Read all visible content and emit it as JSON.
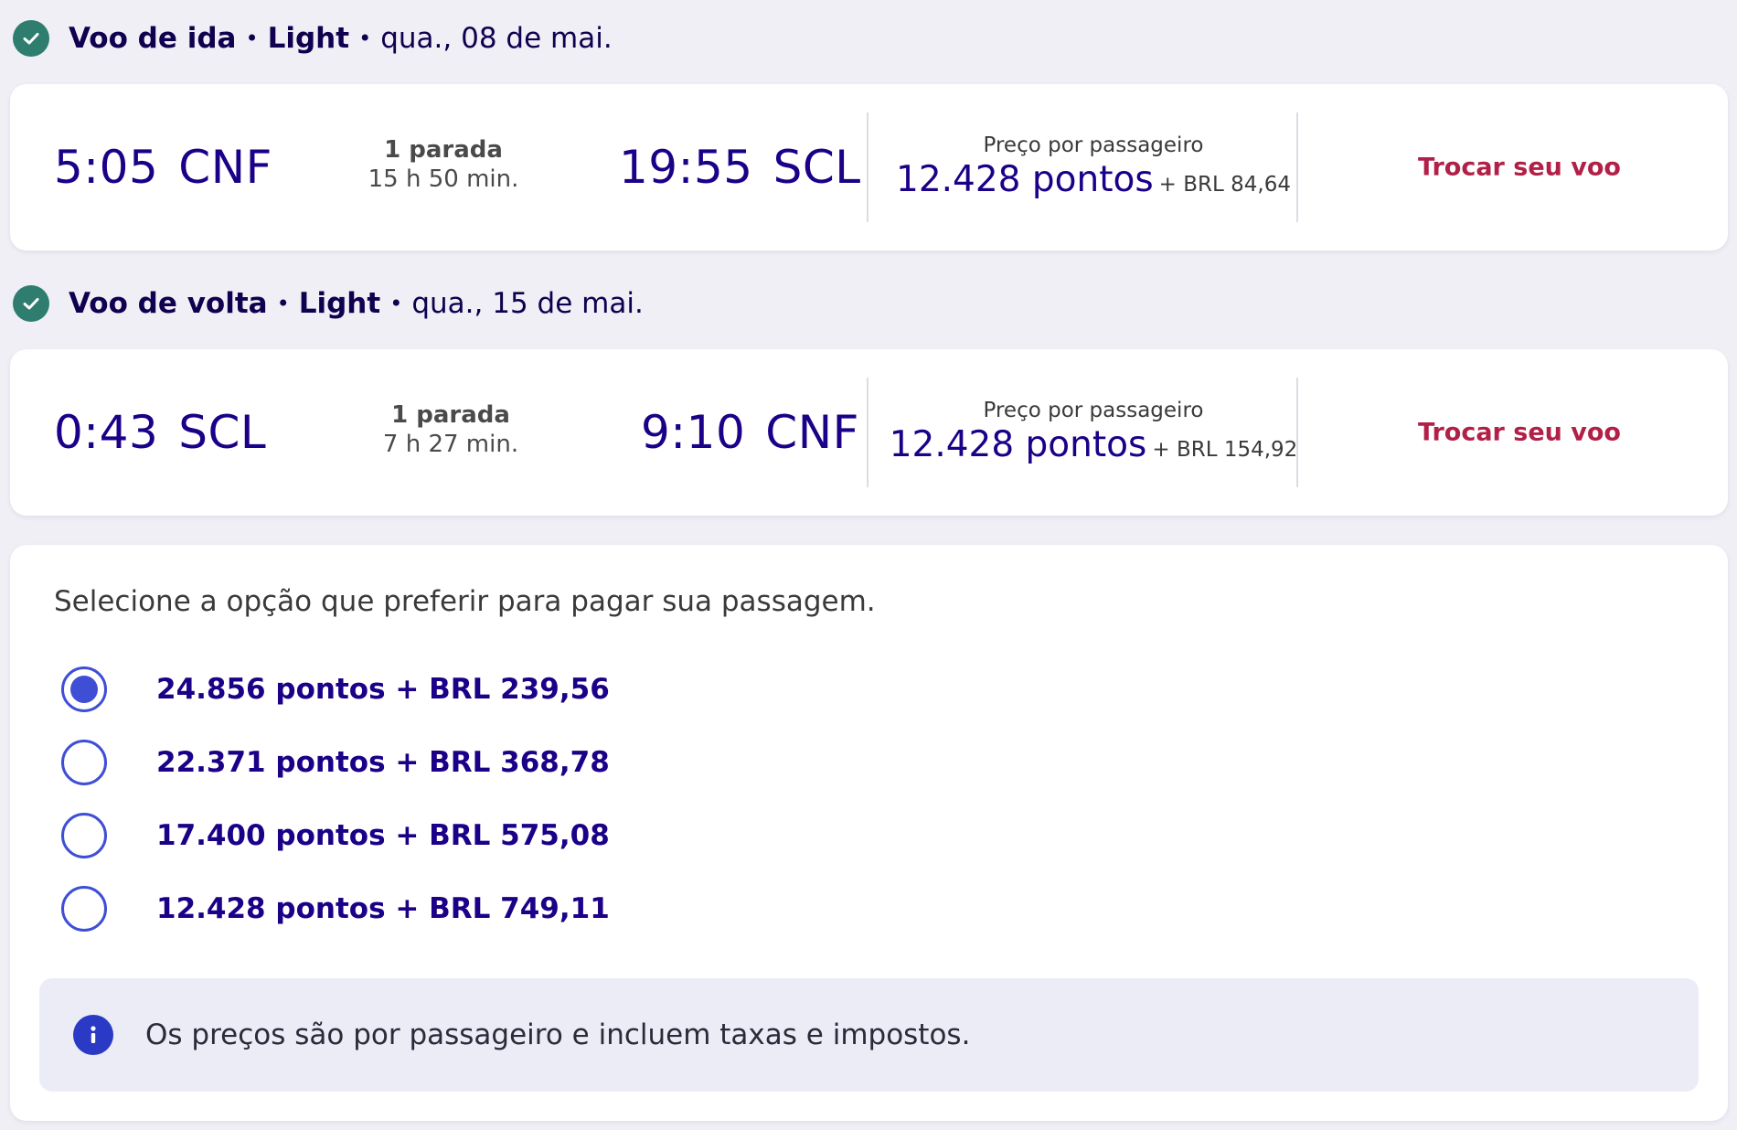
{
  "outbound": {
    "header": {
      "label": "Voo de ida",
      "fare": "Light",
      "date": "qua., 08 de mai."
    },
    "departure_time": "5:05",
    "departure_code": "CNF",
    "stops": "1 parada",
    "duration": "15 h 50 min.",
    "arrival_time": "19:55",
    "arrival_code": "SCL",
    "price_label": "Preço por passageiro",
    "price_points": "12.428 pontos",
    "price_extra": "+ BRL 84,64",
    "change_label": "Trocar seu voo"
  },
  "return": {
    "header": {
      "label": "Voo de volta",
      "fare": "Light",
      "date": "qua., 15 de mai."
    },
    "departure_time": "0:43",
    "departure_code": "SCL",
    "stops": "1 parada",
    "duration": "7 h 27 min.",
    "arrival_time": "9:10",
    "arrival_code": "CNF",
    "price_label": "Preço por passageiro",
    "price_points": "12.428 pontos",
    "price_extra": "+ BRL 154,92",
    "change_label": "Trocar seu voo"
  },
  "separator": "•",
  "payment": {
    "prompt": "Selecione a opção que preferir para pagar sua passagem.",
    "options": [
      {
        "label": "24.856 pontos + BRL 239,56",
        "selected": true
      },
      {
        "label": "22.371 pontos + BRL 368,78",
        "selected": false
      },
      {
        "label": "17.400 pontos + BRL 575,08",
        "selected": false
      },
      {
        "label": "12.428 pontos + BRL 749,11",
        "selected": false
      }
    ],
    "info_text": "Os preços são por passageiro e incluem taxas e impostos."
  },
  "colors": {
    "accent": "#1b0088",
    "link": "#b21f47",
    "radio": "#3e4fd6",
    "check": "#2e7d6e",
    "info_icon": "#2a3ac4"
  },
  "icons": {
    "section_check": "check-circle-icon",
    "info": "info-icon"
  }
}
